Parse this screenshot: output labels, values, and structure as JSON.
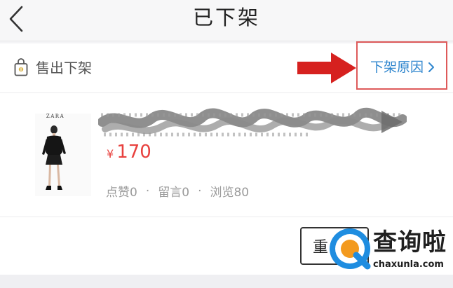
{
  "header": {
    "title": "已下架",
    "back_icon": "chevron-left-icon"
  },
  "status": {
    "icon": "shopping-bag-icon",
    "label": "售出下架",
    "reason_link": "下架原因",
    "reason_icon": "chevron-right-icon"
  },
  "annotation": {
    "arrow_color": "#d6211f",
    "box_color": "#de5a5a"
  },
  "product": {
    "brand": "ZARA",
    "title_obscured": true,
    "currency": "¥",
    "price": "170",
    "likes": "点赞0",
    "comments": "留言0",
    "views": "浏览80",
    "separator": "·"
  },
  "actions": {
    "relist_label": "重"
  },
  "watermark": {
    "name": "查询啦",
    "url": "chaxunla.com"
  },
  "colors": {
    "accent": "#2f86ce",
    "price": "#e8413e",
    "watermark_blue": "#1f8de0",
    "watermark_orange": "#f39a1e"
  }
}
